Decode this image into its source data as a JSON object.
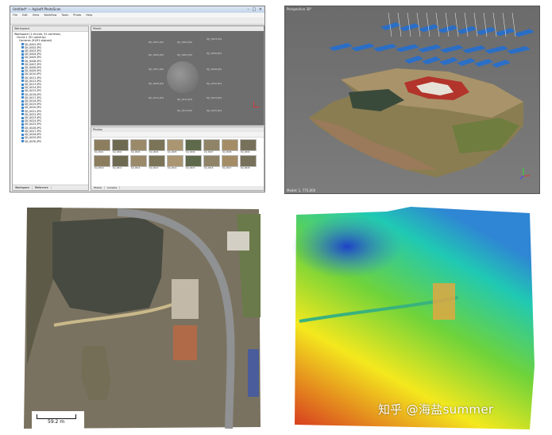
{
  "agisoft_window": {
    "title": "Untitled* — Agisoft PhotoScan",
    "menu": [
      "File",
      "Edit",
      "View",
      "Workflow",
      "Tools",
      "Photo",
      "Help"
    ],
    "workspace_header": "Workspace",
    "workspace_tree": {
      "workspace": "Workspace (1 chunks, 91 cameras)",
      "chunk": "Chunk 1 (91 cameras)",
      "cameras_group": "Cameras (91/91 aligned)",
      "cameras": [
        "DJI_0001.JPG",
        "DJI_0002.JPG",
        "DJI_0003.JPG",
        "DJI_0004.JPG",
        "DJI_0005.JPG",
        "DJI_0006.JPG",
        "DJI_0007.JPG",
        "DJI_0008.JPG",
        "DJI_0009.JPG",
        "DJI_0010.JPG",
        "DJI_0011.JPG",
        "DJI_0012.JPG",
        "DJI_0013.JPG",
        "DJI_0014.JPG",
        "DJI_0015.JPG",
        "DJI_0016.JPG",
        "DJI_0017.JPG",
        "DJI_0018.JPG",
        "DJI_0019.JPG",
        "DJI_0020.JPG",
        "DJI_0021.JPG",
        "DJI_0022.JPG",
        "DJI_0023.JPG",
        "DJI_0024.JPG",
        "DJI_0025.JPG",
        "DJI_0026.JPG",
        "DJI_0027.JPG",
        "DJI_0028.JPG",
        "DJI_0029.JPG",
        "DJI_0030.JPG"
      ]
    },
    "workspace_tabs": [
      "Workspace",
      "Reference"
    ],
    "model_header": "Model",
    "photos_header": "Photos",
    "photo_tabs": [
      "Photos",
      "Console"
    ],
    "thumbnails": [
      "DJI_0001",
      "DJI_0002",
      "DJI_0003",
      "DJI_0004",
      "DJI_0005",
      "DJI_0006",
      "DJI_0007",
      "DJI_0008",
      "DJI_0009",
      "DJI_0010",
      "DJI_0011",
      "DJI_0012",
      "DJI_0013",
      "DJI_0014",
      "DJI_0015",
      "DJI_0016",
      "DJI_0017",
      "DJI_0018"
    ]
  },
  "perspective_view": {
    "label": "Perspective 30°",
    "footer": "Model: 1, 775,000"
  },
  "orthomosaic": {
    "scale_label": "59.2 m"
  },
  "dem": {},
  "watermark": {
    "text": "知乎 @海盐summer"
  },
  "colors": {
    "dem_high": "#d6371f",
    "dem_mid": "#f4e81e",
    "dem_low": "#1e42c8",
    "camera_blue": "#1e6fd6"
  }
}
